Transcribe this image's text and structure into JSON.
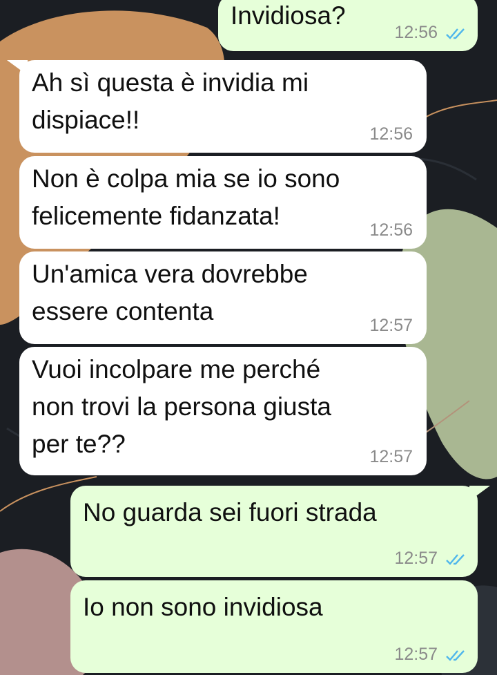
{
  "colors": {
    "incoming_bubble": "#ffffff",
    "outgoing_bubble": "#e6ffd9",
    "read_ticks": "#4fb6ec",
    "timestamp": "#8a8a8a"
  },
  "messages": [
    {
      "direction": "outgoing",
      "text": "Invidiosa?",
      "time": "12:56",
      "status": "read"
    },
    {
      "direction": "incoming",
      "text": "Ah sì questa è invidia mi\ndispiace!!",
      "time": "12:56"
    },
    {
      "direction": "incoming",
      "text": "Non è colpa mia se io sono\nfelicemente fidanzata!",
      "time": "12:56"
    },
    {
      "direction": "incoming",
      "text": "Un'amica vera dovrebbe\nessere contenta",
      "time": "12:57"
    },
    {
      "direction": "incoming",
      "text": "Vuoi incolpare me perché\nnon trovi la persona giusta\nper te??",
      "time": "12:57"
    },
    {
      "direction": "outgoing",
      "text": "No guarda sei fuori strada",
      "time": "12:57",
      "status": "read"
    },
    {
      "direction": "outgoing",
      "text": "Io non sono invidiosa",
      "time": "12:57",
      "status": "read"
    }
  ]
}
